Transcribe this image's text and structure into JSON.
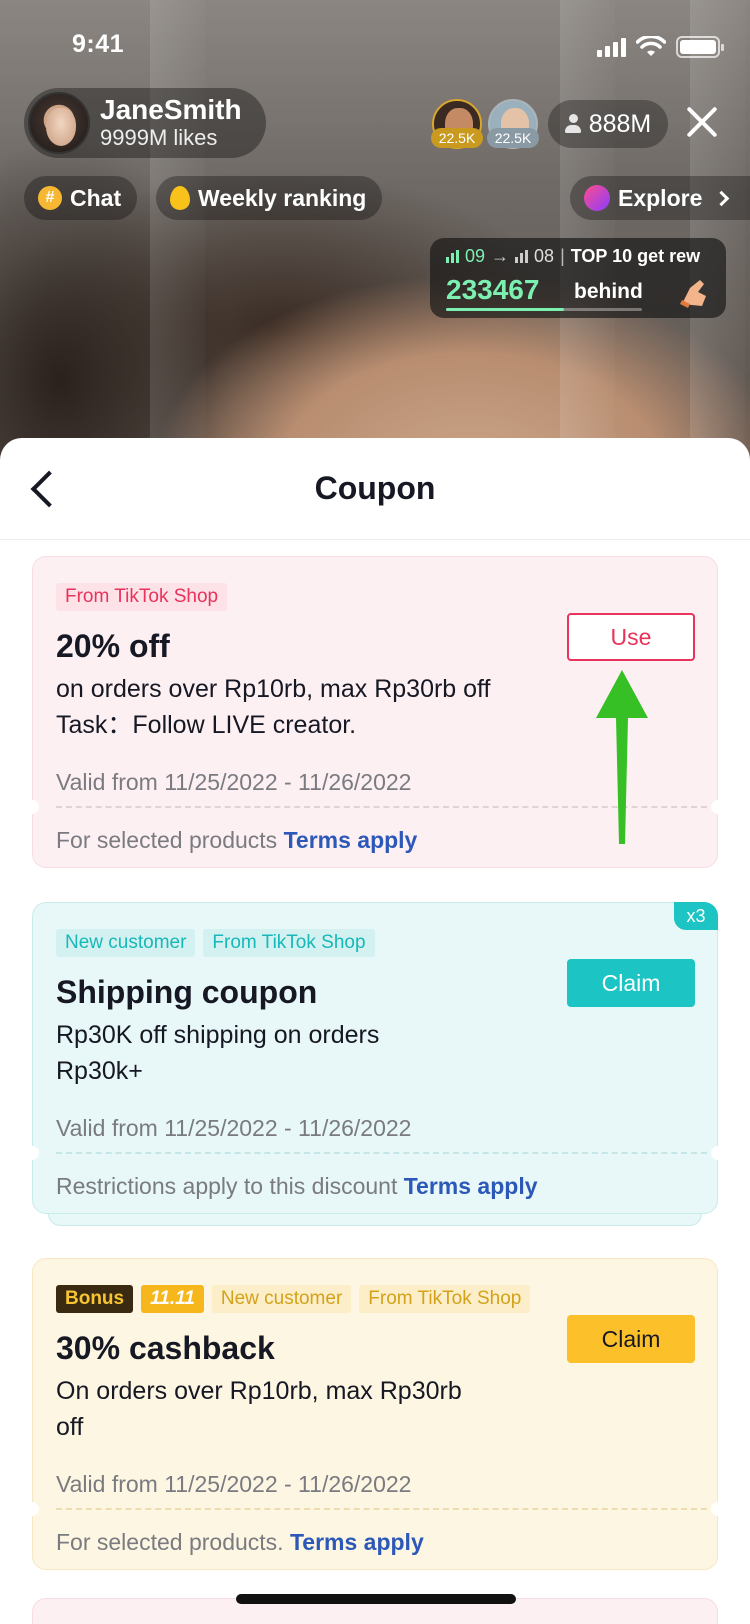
{
  "status_bar": {
    "time": "9:41"
  },
  "live": {
    "host": {
      "name": "JaneSmith",
      "likes": "9999M likes"
    },
    "viewers": [
      {
        "count": "22.5K"
      },
      {
        "count": "22.5K"
      }
    ],
    "viewer_total": "888M",
    "chips": {
      "chat": "Chat",
      "weekly_ranking": "Weekly ranking",
      "explore": "Explore"
    },
    "rank": {
      "current": "09",
      "target": "08",
      "label": "TOP 10 get rew",
      "gap": "233467",
      "behind": "behind",
      "progress": 0.6
    },
    "colors": {
      "accent_green": "#7bf0b0"
    }
  },
  "sheet": {
    "title": "Coupon"
  },
  "coupons": [
    {
      "tags": [
        "From TikTok Shop"
      ],
      "title": "20% off",
      "description": "on orders over Rp10rb, max Rp30rb off\nTask：Follow LIVE creator.",
      "valid": "Valid from 11/25/2022 - 11/26/2022",
      "footer": "For selected products",
      "terms": "Terms apply",
      "button": "Use",
      "color": "#fdf0f3"
    },
    {
      "tags": [
        "New customer",
        "From TikTok Shop"
      ],
      "title": "Shipping coupon",
      "description": "Rp30K off shipping on orders\nRp30k+",
      "valid": "Valid from 11/25/2022 - 11/26/2022",
      "footer": "Restrictions apply to this discount",
      "terms": "Terms apply",
      "button": "Claim",
      "multiplier": "x3",
      "color": "#e8f7f7"
    },
    {
      "tags": [
        "Bonus",
        "11.11",
        "New customer",
        "From TikTok Shop"
      ],
      "title": "30% cashback",
      "description": "On orders over Rp10rb, max Rp30rb\noff",
      "valid": "Valid from 11/25/2022 - 11/26/2022",
      "footer": "For selected products.",
      "terms": "Terms apply",
      "button": "Claim",
      "color": "#fdf6e3"
    }
  ],
  "annotation": {
    "arrow_color": "#36c026"
  }
}
